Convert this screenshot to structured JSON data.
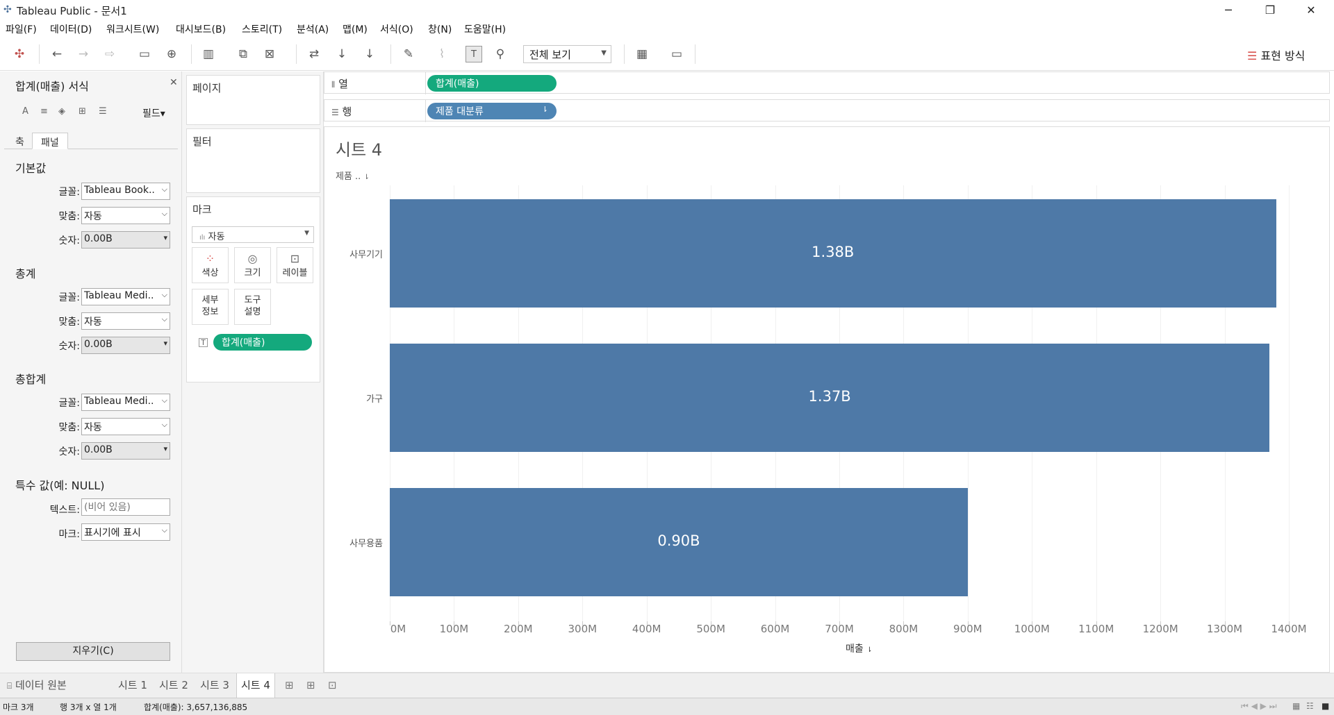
{
  "window": {
    "title": "Tableau Public - 문서1"
  },
  "menu": [
    "파일(F)",
    "데이터(D)",
    "워크시트(W)",
    "대시보드(B)",
    "스토리(T)",
    "분석(A)",
    "맵(M)",
    "서식(O)",
    "창(N)",
    "도움말(H)"
  ],
  "toolbar": {
    "view_mode": "전체 보기",
    "show_me": "표현 방식"
  },
  "format_pane": {
    "title": "합계(매출) 서식",
    "fields_label": "필드▾",
    "tabs": [
      "축",
      "패널"
    ],
    "sections": {
      "default": {
        "title": "기본값",
        "font_label": "글꼴:",
        "font": "Tableau Book..",
        "align_label": "맞춤:",
        "align": "자동",
        "number_label": "숫자:",
        "number": "0.00B"
      },
      "totals": {
        "title": "총계",
        "font_label": "글꼴:",
        "font": "Tableau Medi..",
        "align_label": "맞춤:",
        "align": "자동",
        "number_label": "숫자:",
        "number": "0.00B"
      },
      "grand_totals": {
        "title": "총합계",
        "font_label": "글꼴:",
        "font": "Tableau Medi..",
        "align_label": "맞춤:",
        "align": "자동",
        "number_label": "숫자:",
        "number": "0.00B"
      },
      "special": {
        "title": "특수 값(예: NULL)",
        "text_label": "텍스트:",
        "text_placeholder": "(비어 있음)",
        "marks_label": "마크:",
        "marks": "표시기에 표시"
      }
    },
    "clear_button": "지우기(C)"
  },
  "cards": {
    "pages": "페이지",
    "filters": "필터",
    "marks": {
      "title": "마크",
      "type": "자동",
      "buttons": {
        "color": "색상",
        "size": "크기",
        "label": "레이블",
        "detail": "세부\n정보",
        "tooltip": "도구\n설명"
      },
      "pill": "합계(매출)"
    }
  },
  "shelves": {
    "columns": {
      "label": "열",
      "pill": "합계(매출)"
    },
    "rows": {
      "label": "행",
      "pill": "제품 대분류"
    }
  },
  "sheet": {
    "title": "시트 4",
    "row_header": "제품 .."
  },
  "chart_data": {
    "type": "bar",
    "orientation": "horizontal",
    "categories": [
      "사무기기",
      "가구",
      "사무용품"
    ],
    "values": [
      1380000000,
      1370000000,
      900000000
    ],
    "data_labels": [
      "1.38B",
      "1.37B",
      "0.90B"
    ],
    "xlabel": "매출",
    "xlim": [
      0,
      1400000000
    ],
    "x_ticks": [
      "0M",
      "100M",
      "200M",
      "300M",
      "400M",
      "500M",
      "600M",
      "700M",
      "800M",
      "900M",
      "1000M",
      "1100M",
      "1200M",
      "1300M",
      "1400M"
    ],
    "bar_color": "#4e79a7",
    "grid": true
  },
  "sheet_tabs": {
    "datasource": "데이터 원본",
    "tabs": [
      "시트 1",
      "시트 2",
      "시트 3",
      "시트 4"
    ]
  },
  "status": {
    "marks": "마크 3개",
    "dims": "행 3개 x 열 1개",
    "sum": "합계(매출): 3,657,136,885"
  },
  "colors": {
    "pill_measure": "#14a97d",
    "pill_dimension": "#4e85b4"
  }
}
